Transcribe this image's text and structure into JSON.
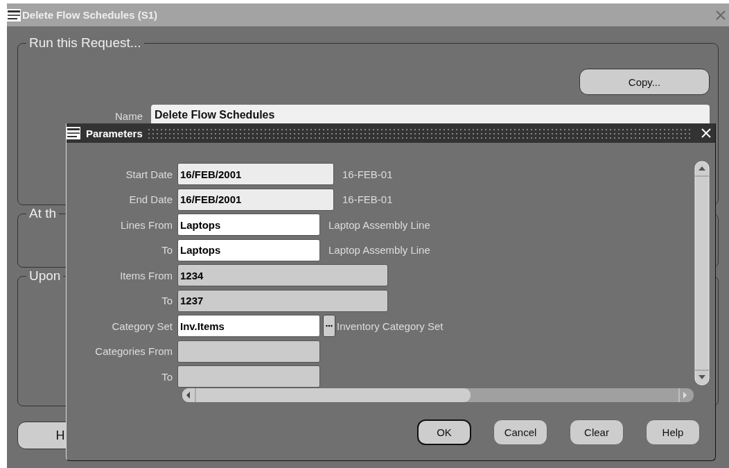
{
  "window": {
    "title": "Delete Flow Schedules (S1)"
  },
  "background": {
    "groups": [
      {
        "title": "Run this Request..."
      },
      {
        "title": "At th"
      },
      {
        "title": "Upon"
      }
    ],
    "copy_button": "Copy...",
    "name_label": "Name",
    "name_value": "Delete Flow Schedules",
    "left_button": "H"
  },
  "dialog": {
    "title": "Parameters",
    "fields": [
      {
        "label": "Start Date",
        "value": "16/FEB/2001",
        "kind": "date",
        "disabled": false,
        "description": "16-FEB-01"
      },
      {
        "label": "End Date",
        "value": "16/FEB/2001",
        "kind": "date",
        "disabled": false,
        "description": "16-FEB-01"
      },
      {
        "label": "Lines From",
        "value": "Laptops",
        "kind": "text",
        "disabled": false,
        "description": "Laptop Assembly Line"
      },
      {
        "label": "To",
        "value": "Laptops",
        "kind": "text",
        "disabled": false,
        "description": "Laptop Assembly Line"
      },
      {
        "label": "Items From",
        "value": "1234",
        "disabled": true
      },
      {
        "label": "To",
        "value": "1237",
        "disabled": true
      },
      {
        "label": "Category Set",
        "value": "Inv.Items",
        "kind": "text",
        "disabled": false,
        "lookup": true,
        "description": "Inventory Category Set"
      },
      {
        "label": "Categories From",
        "disabled": true
      },
      {
        "label": "To",
        "disabled": true
      }
    ],
    "buttons": [
      {
        "label": "OK",
        "default": true
      },
      {
        "label": "Cancel",
        "default": false
      },
      {
        "label": "Clear",
        "default": false
      },
      {
        "label": "Help",
        "default": false
      }
    ]
  }
}
